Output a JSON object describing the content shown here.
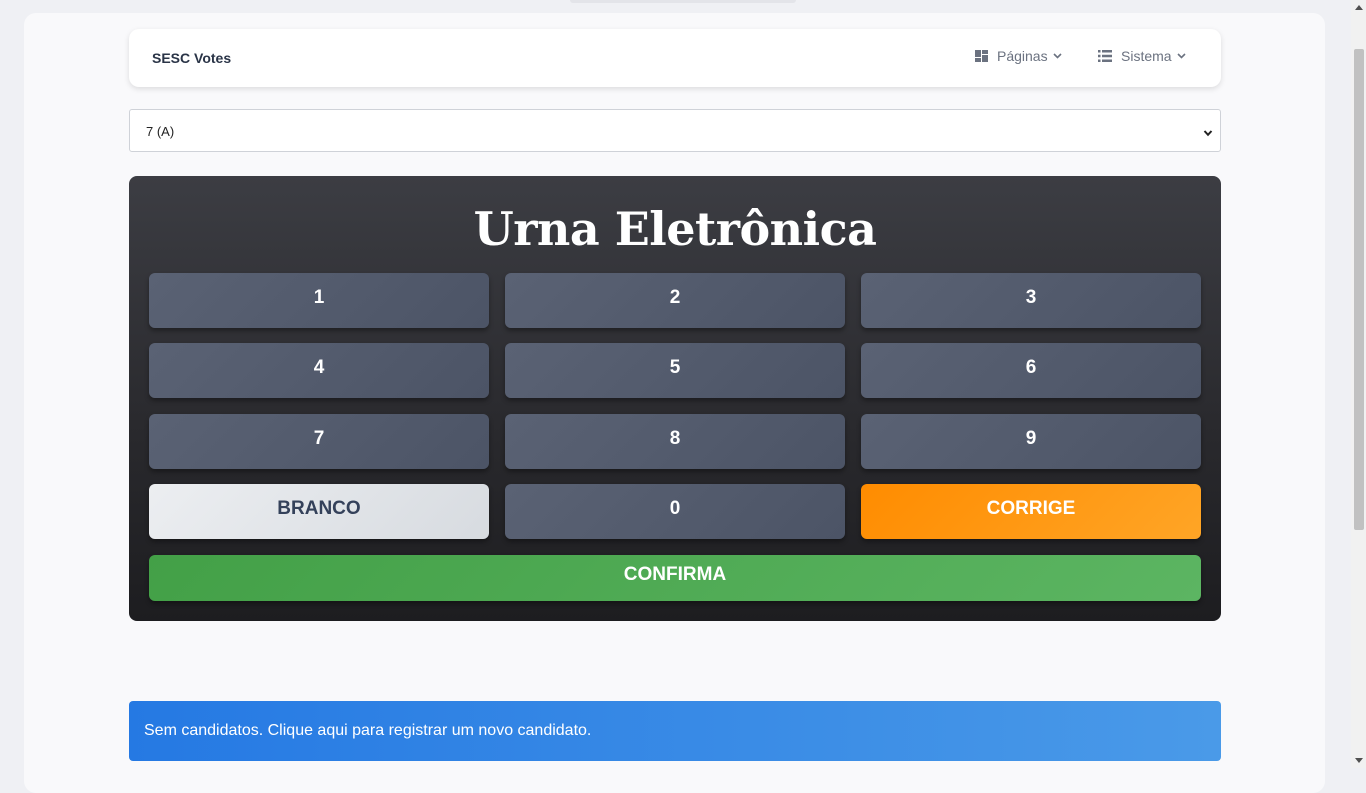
{
  "navbar": {
    "brand": "SESC Votes",
    "menus": [
      {
        "label": "Páginas",
        "icon": "grid-icon"
      },
      {
        "label": "Sistema",
        "icon": "list-icon"
      }
    ]
  },
  "turma_select": {
    "selected": "7 (A)"
  },
  "urna": {
    "title": "Urna Eletrônica",
    "keys": [
      "1",
      "2",
      "3",
      "4",
      "5",
      "6",
      "7",
      "8",
      "9"
    ],
    "branco": "BRANCO",
    "zero": "0",
    "corrige": "CORRIGE",
    "confirma": "CONFIRMA"
  },
  "alert": {
    "text": "Sem candidatos. Clique aqui para registrar um novo candidato."
  },
  "colors": {
    "branco": "#dde1e6",
    "corrige": "#ff9512",
    "confirma": "#4caf50",
    "alert": "#2f83e6"
  }
}
